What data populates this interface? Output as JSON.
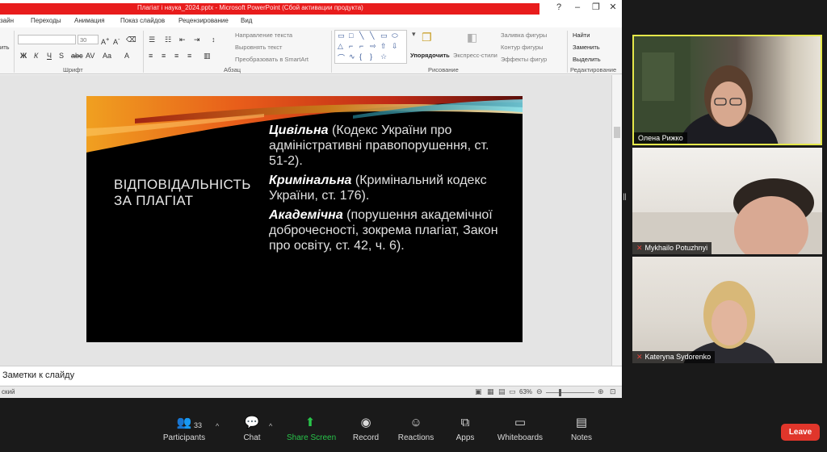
{
  "ppt": {
    "window_title": "Плагіат і наука_2024.pptx   -   Microsoft PowerPoint (Сбой активации продукта)",
    "menu": [
      "зайн",
      "Переходы",
      "Анимация",
      "Показ слайдов",
      "Рецензирование",
      "Вид"
    ],
    "ribbon": {
      "font_size": "30",
      "left_edge_label": "ить",
      "text_direction": "Направление текста",
      "align_text": "Выровнять текст",
      "smartart": "Преобразовать в SmartArt",
      "arrange": "Упорядочить",
      "quick_styles": "Экспресс-стили",
      "shape_fill": "Заливка фигуры",
      "shape_outline": "Контур фигуры",
      "shape_effects": "Эффекты фигур",
      "find": "Найти",
      "replace": "Заменить",
      "select": "Выделить",
      "groups": {
        "font": "Шрифт",
        "paragraph": "Абзац",
        "drawing": "Рисование",
        "editing": "Редактирование"
      }
    },
    "slide": {
      "title": "ВІДПОВІДАЛЬНІСТЬ ЗА ПЛАГІАТ",
      "items": [
        {
          "bold": "Цивільна",
          "text": " (Кодекс України про адміністративні правопорушення, ст. 51-2)."
        },
        {
          "bold": "Кримінальна",
          "text": " (Кримінальний кодекс України, ст. 176)."
        },
        {
          "bold": "Академічна",
          "text": " (порушення академічної доброчесності, зокрема плагіат, Закон про освіту, ст. 42, ч. 6)."
        }
      ]
    },
    "notes_placeholder": "Заметки к слайду",
    "status": {
      "language": "ский",
      "zoom": "63%"
    }
  },
  "participants": [
    {
      "name": "Олена Рижко",
      "muted": false,
      "active_speaker": true
    },
    {
      "name": "Mykhailo Potuzhnyi",
      "muted": true,
      "active_speaker": false
    },
    {
      "name": "Kateryna Sydorenko",
      "muted": true,
      "active_speaker": false
    }
  ],
  "toolbar": {
    "participants_label": "Participants",
    "participants_count": "33",
    "chat_label": "Chat",
    "share_label": "Share Screen",
    "record_label": "Record",
    "reactions_label": "Reactions",
    "apps_label": "Apps",
    "whiteboards_label": "Whiteboards",
    "notes_label": "Notes",
    "leave_label": "Leave"
  },
  "colors": {
    "share_green": "#28c44a",
    "leave_red": "#e0362b",
    "speaker_border": "#e5e84a",
    "ppt_titlebar_red": "#e81c1c"
  }
}
